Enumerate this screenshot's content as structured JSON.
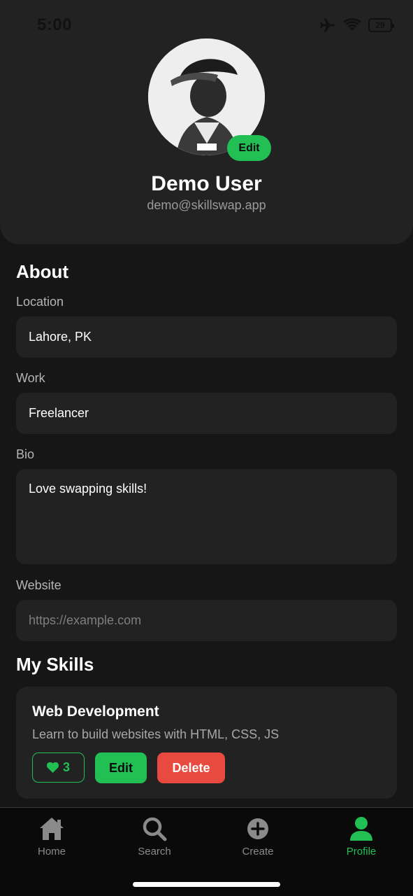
{
  "status_bar": {
    "time": "5:00",
    "battery": "29"
  },
  "profile": {
    "name": "Demo User",
    "email": "demo@skillswap.app",
    "edit_label": "Edit"
  },
  "about": {
    "title": "About",
    "location": {
      "label": "Location",
      "value": "Lahore, PK"
    },
    "work": {
      "label": "Work",
      "value": "Freelancer"
    },
    "bio": {
      "label": "Bio",
      "value": "Love swapping skills!"
    },
    "website": {
      "label": "Website",
      "placeholder": "https://example.com"
    }
  },
  "skills": {
    "title": "My Skills",
    "items": [
      {
        "title": "Web Development",
        "description": "Learn to build websites with HTML, CSS, JS",
        "likes": "3",
        "edit_label": "Edit",
        "delete_label": "Delete"
      }
    ]
  },
  "tab_bar": {
    "tabs": [
      {
        "label": "Home",
        "icon": "home-icon"
      },
      {
        "label": "Search",
        "icon": "search-icon"
      },
      {
        "label": "Create",
        "icon": "plus-circle-icon"
      },
      {
        "label": "Profile",
        "icon": "person-icon",
        "active": true
      }
    ]
  },
  "colors": {
    "accent": "#22bf55",
    "danger": "#e84a3f",
    "surface": "#222222",
    "background": "#161616"
  }
}
